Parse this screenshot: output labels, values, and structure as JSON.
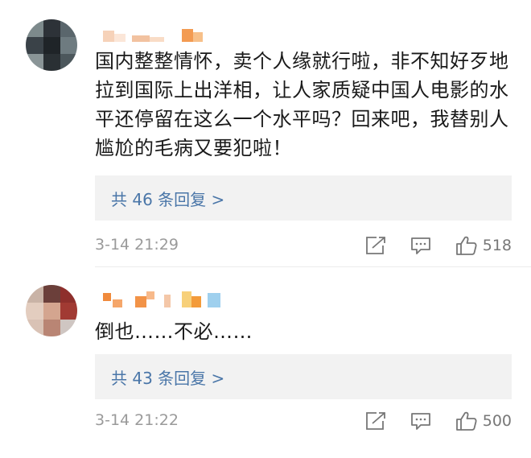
{
  "comments": [
    {
      "text": "国内整整情怀，卖个人缘就行啦，非不知好歹地拉到国际上出洋相，让人家质疑中国人电影的水平还停留在这么一个水平吗？回来吧，我替别人尴尬的毛病又要犯啦！",
      "replies_label": "共 46 条回复 >",
      "timestamp": "3-14 21:29",
      "likes": "518"
    },
    {
      "text": "倒也……不必……",
      "replies_label": "共 43 条回复 >",
      "timestamp": "3-14 21:22",
      "likes": "500"
    }
  ],
  "icons": {
    "share": "share-icon",
    "comment": "comment-icon",
    "like": "like-icon"
  },
  "colors": {
    "link": "#4a76a8",
    "meta": "#9a9a9a",
    "box": "#f2f2f2"
  }
}
